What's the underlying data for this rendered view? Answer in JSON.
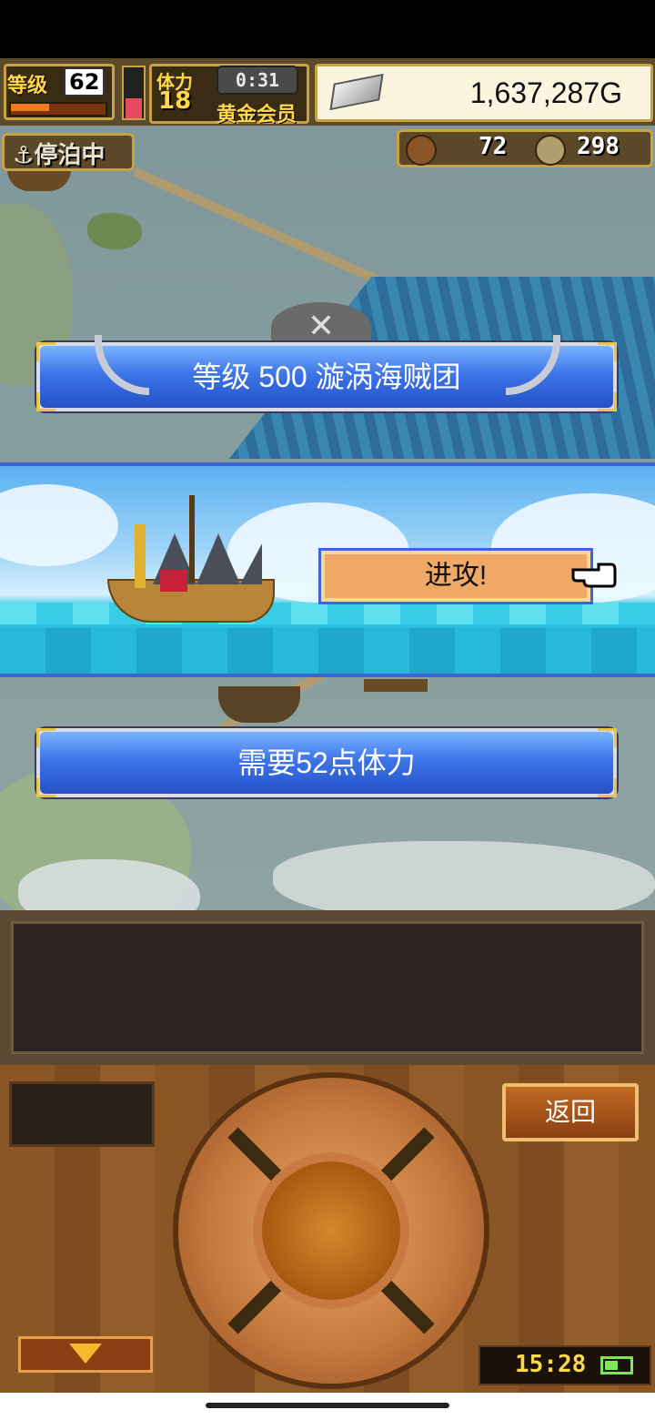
{
  "hud": {
    "level_label": "等级",
    "level_value": "62",
    "stamina_label": "体力",
    "stamina_value": "18",
    "timer": "0:31",
    "membership": "黄金会员",
    "gold": "1,637,287G",
    "anchor_status": "停泊中",
    "resource_a": "72",
    "resource_b": "298"
  },
  "colors": {
    "accent_blue": "#3c66d8",
    "attack_orange": "#f0a866",
    "gold_text": "#ffd84a"
  },
  "event": {
    "title": "等级 500 漩涡海贼团",
    "attack_label": "进攻!",
    "requirement": "需要52点体力"
  },
  "controls": {
    "back_label": "返回",
    "clock": "15:28"
  }
}
